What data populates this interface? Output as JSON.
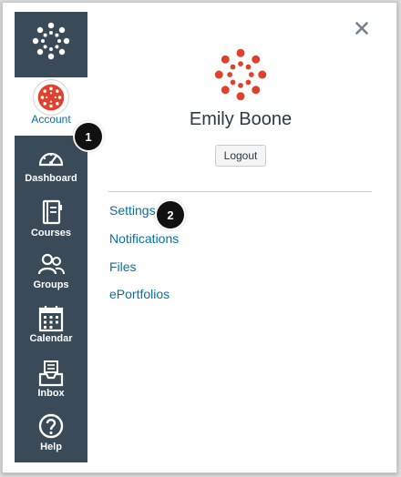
{
  "colors": {
    "nav_background": "#394b58",
    "brand_red": "#e0412d",
    "link_blue": "#0770a3",
    "text_dark": "#2d3b45"
  },
  "global_nav": {
    "logo_icon": "canvas-logo-icon",
    "account": {
      "label": "Account",
      "icon": "canvas-avatar-icon"
    },
    "items": [
      {
        "label": "Dashboard",
        "icon": "dashboard-icon"
      },
      {
        "label": "Courses",
        "icon": "courses-icon"
      },
      {
        "label": "Groups",
        "icon": "groups-icon"
      },
      {
        "label": "Calendar",
        "icon": "calendar-icon"
      },
      {
        "label": "Inbox",
        "icon": "inbox-icon"
      },
      {
        "label": "Help",
        "icon": "help-icon"
      }
    ]
  },
  "tray": {
    "close_icon": "close-icon",
    "user_name": "Emily Boone",
    "logout_label": "Logout",
    "links": [
      "Settings",
      "Notifications",
      "Files",
      "ePortfolios"
    ]
  },
  "callouts": [
    "1",
    "2"
  ]
}
